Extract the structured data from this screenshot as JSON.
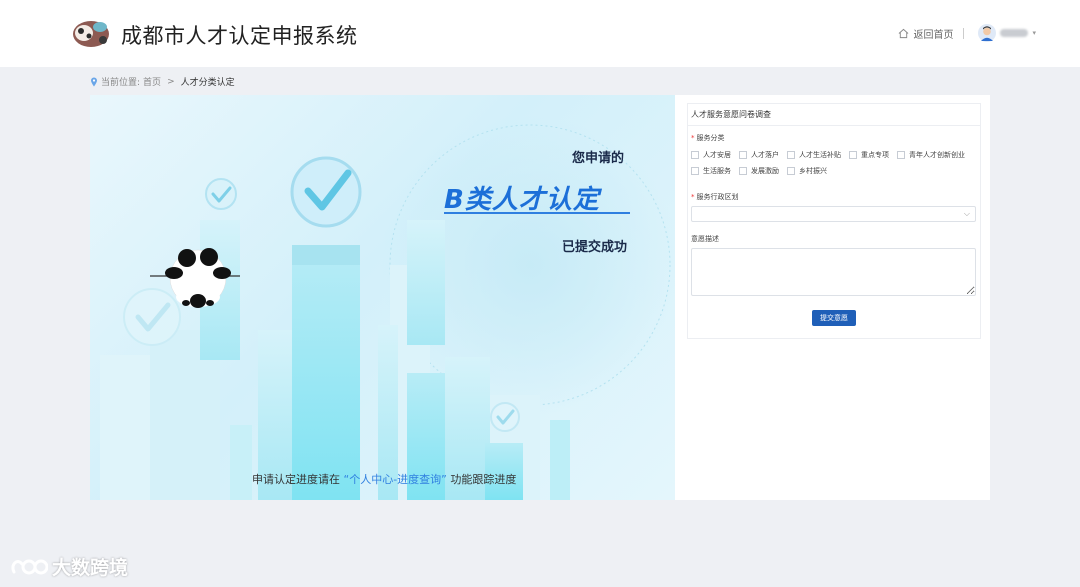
{
  "header": {
    "title": "成都市人才认定申报系统",
    "home_label": "返回首页"
  },
  "breadcrumb": {
    "prefix": "当前位置:",
    "home": "首页",
    "separator": ">",
    "current": "人才分类认定"
  },
  "hero": {
    "line1": "您申请的",
    "category": "B类人才认定",
    "line3": "已提交成功",
    "footer_prefix": "申请认定进度请在",
    "footer_highlight": "“个人中心-进度查询”",
    "footer_suffix": "功能跟踪进度"
  },
  "survey": {
    "title": "人才服务意愿问卷调查",
    "category_label": "服务分类",
    "categories_row1": [
      "人才安居",
      "人才落户",
      "人才生活补贴",
      "重点专项",
      "青年人才创新创业"
    ],
    "categories_row2": [
      "生活服务",
      "发展激励",
      "乡村振兴"
    ],
    "district_label": "服务行政区划",
    "district_value": "",
    "desc_label": "意愿描述",
    "desc_value": "",
    "submit_label": "提交意愿"
  },
  "watermark": {
    "text": "大数跨境"
  },
  "colors": {
    "accent": "#1f5fb8",
    "highlight": "#2f7fe0",
    "required": "#ee3333",
    "hero_bg": "#d3f0fa"
  },
  "icons": [
    "panda-logo-icon",
    "home-icon",
    "user-avatar-icon",
    "location-pin-icon",
    "checkmark-icon",
    "chevron-down-icon"
  ]
}
